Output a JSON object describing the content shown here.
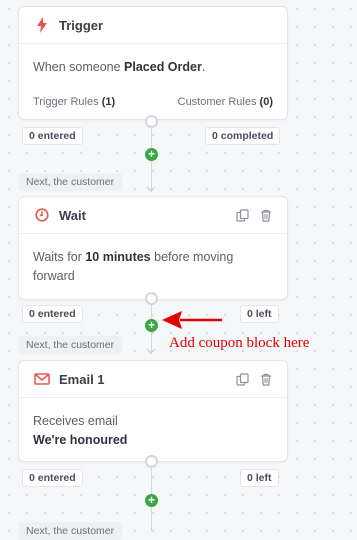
{
  "trigger": {
    "title": "Trigger",
    "desc_prefix": "When someone ",
    "desc_bold": "Placed Order",
    "desc_suffix": ".",
    "rules_label": "Trigger Rules",
    "rules_count": "(1)",
    "customer_rules_label": "Customer Rules",
    "customer_rules_count": "(0)",
    "entered": "0 entered",
    "completed": "0 completed"
  },
  "next_label": "Next, the customer",
  "next_label_partial": "Next, the customer",
  "wait": {
    "title": "Wait",
    "desc_prefix": "Waits for ",
    "desc_bold": "10 minutes",
    "desc_suffix": " before moving forward",
    "entered": "0 entered",
    "left": "0 left"
  },
  "email": {
    "title": "Email 1",
    "desc_line1": "Receives email",
    "desc_bold": "We're honoured",
    "entered": "0 entered",
    "left": "0 left"
  },
  "annotation": "Add coupon block here",
  "colors": {
    "accent": "#e8554e",
    "add": "#3aa745",
    "annotation": "#e00000"
  },
  "icons": [
    "bolt-icon",
    "clock-icon",
    "envelope-icon",
    "copy-icon",
    "trash-icon",
    "plus-icon"
  ]
}
